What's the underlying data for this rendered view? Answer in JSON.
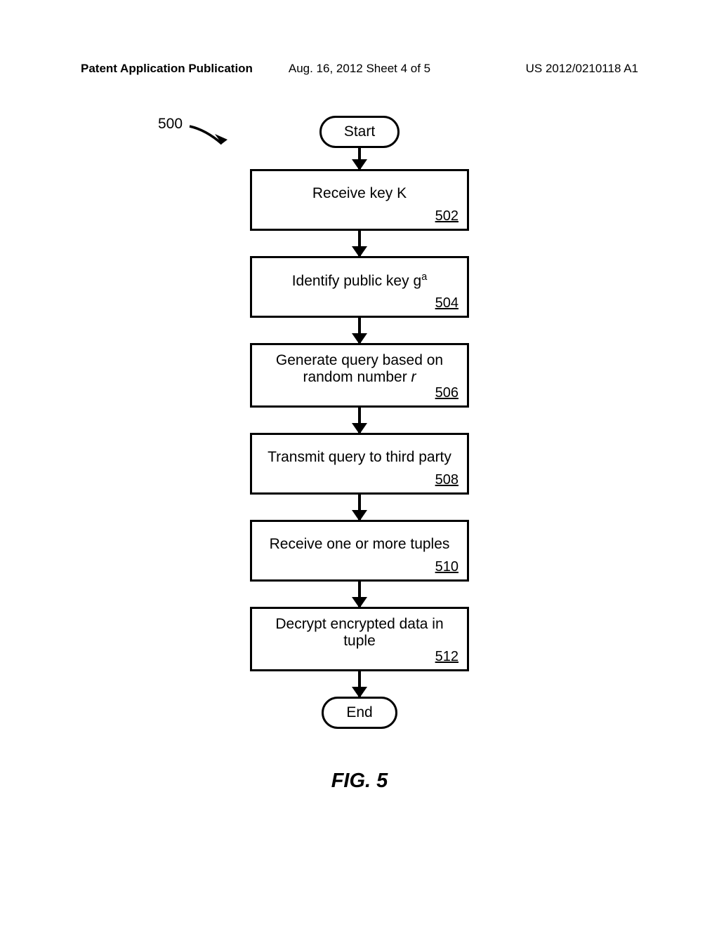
{
  "header": {
    "left": "Patent Application Publication",
    "center": "Aug. 16, 2012  Sheet 4 of 5",
    "right": "US 2012/0210118 A1"
  },
  "ref": {
    "label": "500"
  },
  "steps": {
    "start": "Start",
    "s502": {
      "text": "Receive key K",
      "num": "502"
    },
    "s504": {
      "text_pre": "Identify public key g",
      "sup": "a",
      "num": "504"
    },
    "s506": {
      "text_line1": "Generate query based on",
      "text_line2_pre": "random number ",
      "italic": "r",
      "num": "506"
    },
    "s508": {
      "text": "Transmit query to third party",
      "num": "508"
    },
    "s510": {
      "text": "Receive one or more tuples",
      "num": "510"
    },
    "s512": {
      "text": "Decrypt encrypted data in tuple",
      "num": "512"
    },
    "end": "End"
  },
  "figure": "FIG. 5"
}
